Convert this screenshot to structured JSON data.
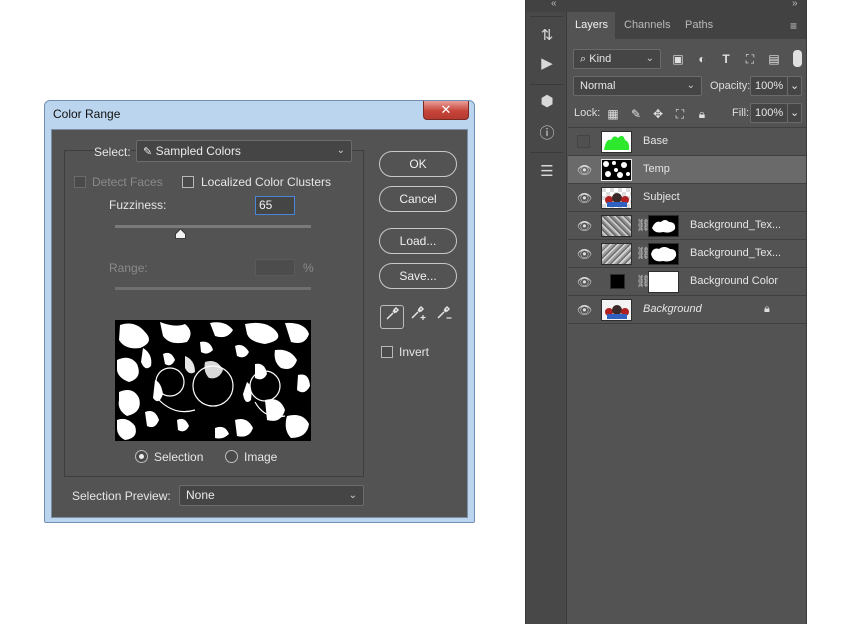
{
  "dialog": {
    "title": "Color Range",
    "close_glyph": "✕",
    "select_label": "Select:",
    "select_value": "Sampled Colors",
    "detect_faces_label": "Detect Faces",
    "localized_label": "Localized Color Clusters",
    "fuzziness_label": "Fuzziness:",
    "fuzziness_value": "65",
    "fuzziness_fraction": 0.33,
    "range_label": "Range:",
    "range_unit": "%",
    "radio_selection": "Selection",
    "radio_image": "Image",
    "preview_label": "Selection Preview:",
    "preview_value": "None",
    "buttons": {
      "ok": "OK",
      "cancel": "Cancel",
      "load": "Load...",
      "save": "Save..."
    },
    "invert_label": "Invert"
  },
  "layers_panel": {
    "tabs": [
      "Layers",
      "Channels",
      "Paths"
    ],
    "filter_value": "Kind",
    "blend_mode": "Normal",
    "opacity_label": "Opacity:",
    "opacity_value": "100%",
    "lock_label": "Lock:",
    "fill_label": "Fill:",
    "fill_value": "100%",
    "layers": [
      {
        "name": "Base",
        "visible": false,
        "selected": false,
        "thumb": "green",
        "mask": null,
        "locked": false,
        "italic": false
      },
      {
        "name": "Temp",
        "visible": true,
        "selected": true,
        "thumb": "noise-bw",
        "mask": null,
        "locked": false,
        "italic": false
      },
      {
        "name": "Subject",
        "visible": true,
        "selected": false,
        "thumb": "subject",
        "mask": null,
        "locked": false,
        "italic": false
      },
      {
        "name": "Background_Tex...",
        "visible": true,
        "selected": false,
        "thumb": "noise-grey",
        "mask": "cloud-white",
        "locked": false,
        "italic": false
      },
      {
        "name": "Background_Tex...",
        "visible": true,
        "selected": false,
        "thumb": "noise-grey",
        "mask": "cloud-white2",
        "locked": false,
        "italic": false
      },
      {
        "name": "Background Color",
        "visible": true,
        "selected": false,
        "thumb": "black",
        "mask": "white",
        "locked": false,
        "italic": false
      },
      {
        "name": "Background",
        "visible": true,
        "selected": false,
        "thumb": "subject",
        "mask": null,
        "locked": true,
        "italic": true
      }
    ]
  },
  "colors": {
    "panel_bg": "#535353",
    "dialog_frame": "#bcd5ee",
    "selected_layer": "#6a6a6a",
    "green_thumb": "#2ee82e"
  }
}
